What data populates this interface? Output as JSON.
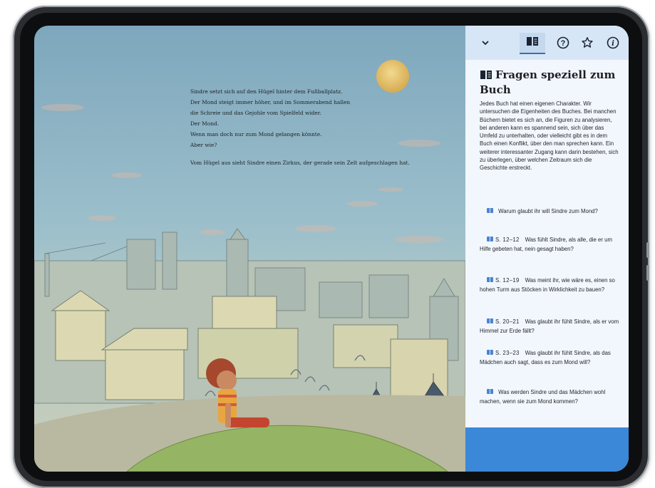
{
  "story": {
    "lines": [
      "Sindre setzt sich auf den Hügel hinter dem Fußballplatz.",
      "Der Mond steigt immer höher, und im Sommerabend hallen",
      "die Schreie und das Gejohle vom Spielfeld wider.",
      "Der Mond.",
      "Wenn man doch nur zum Mond gelangen könnte.",
      "Aber wie?"
    ],
    "closing": "Vom Hügel aus sieht Sindre einen Zirkus, der gerade sein Zelt aufgeschlagen hat."
  },
  "toolbar": {
    "collapse_icon": "⌄",
    "book_icon": "book-icon",
    "help_icon": "?",
    "star_icon": "☆",
    "info_icon": "i"
  },
  "panel": {
    "title": "Fragen speziell zum Buch",
    "intro": "Jedes Buch hat einen eigenen Charakter. Wir untersuchen die Eigenheiten des Buches. Bei manchen Büchern bietet es sich an, die Figuren zu analysieren, bei anderen kann es spannend sein, sich über das Umfeld zu unterhalten, oder vielleicht gibt es in dem Buch einen Konflikt, über den man sprechen kann. Ein weiterer interessanter Zugang kann darin bestehen, sich zu überlegen, über welchen Zeitraum sich die Geschichte erstreckt.",
    "questions": [
      {
        "ref": "",
        "text": "Warum glaubt ihr will Sindre zum Mond?"
      },
      {
        "ref": "S. 12–12",
        "text": "Was fühlt Sindre, als alle, die er um Hilfe gebeten hat, nein gesagt haben?"
      },
      {
        "ref": "S. 12–19",
        "text": "Was meint ihr, wie wäre es, einen so hohen Turm aus Stöcken in Wirklichkeit zu bauen?"
      },
      {
        "ref": "S. 20–21",
        "text": "Was glaubt ihr fühlt Sindre, als er vom Himmel zur Erde fällt?"
      },
      {
        "ref": "S. 23–23",
        "text": "Was glaubt ihr fühlt Sindre, als das Mädchen auch sagt, dass es zum Mond will?"
      },
      {
        "ref": "",
        "text": "Was werden Sindre und das Mädchen wohl machen, wenn sie zum Mond kommen?"
      }
    ]
  },
  "colors": {
    "panel_bg": "#f2f7fd",
    "toolbar_bg": "#d7e6f6",
    "accent": "#3b87d8",
    "sky": "#8fb4c6"
  }
}
